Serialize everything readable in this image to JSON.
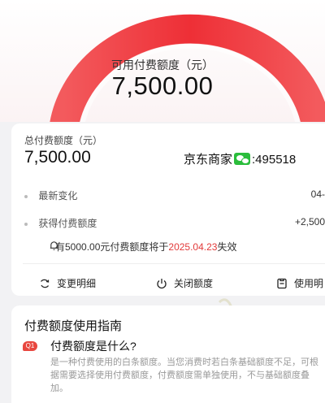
{
  "hero": {
    "available_label": "可用付费额度（元）",
    "available_amount": "7,500.00",
    "gauge_level": 1.0,
    "colors": {
      "gauge": "#ee3a3e"
    }
  },
  "summary": {
    "total_label": "总付费额度（元）",
    "total_amount": "7,500.00",
    "overlay_text": "京东商家",
    "overlay_number": ":495518",
    "rows": [
      {
        "label": "最新变化",
        "value": "04-"
      },
      {
        "label": "获得付费额度",
        "value": "+2,500"
      }
    ],
    "notice": {
      "prefix": "有5000.00元付费额度将于",
      "date": "2025.04.23",
      "suffix": "失效"
    },
    "actions": [
      {
        "label": "变更明细",
        "icon": "refresh-icon"
      },
      {
        "label": "关闭额度",
        "icon": "power-icon"
      },
      {
        "label": "使用明",
        "icon": "document-icon"
      }
    ]
  },
  "guide": {
    "title": "付费额度使用指南",
    "q1_badge": "Q1",
    "q1_title": "付费额度是什么?",
    "q1_body": "是一种付费使用的白条额度。当您消费时若白条基础额度不足，可根据需要选择使用付费额度，付费额度需单独使用，不与基础额度叠加。"
  },
  "colors": {
    "accent": "#e23a3a",
    "wechat": "#2bbd3c"
  }
}
